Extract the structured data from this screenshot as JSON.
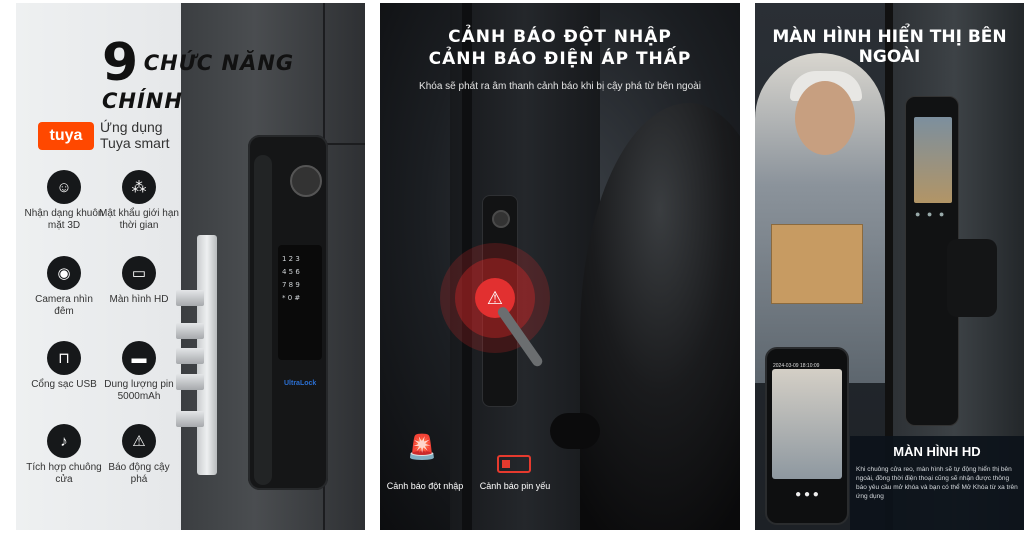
{
  "panel1": {
    "title_number": "9",
    "title_text": "CHỨC NĂNG CHÍNH",
    "app": {
      "logo": "tuya",
      "line1": "Ứng dụng",
      "line2": "Tuya smart"
    },
    "features": [
      {
        "icon": "face-scan-icon",
        "glyph": "☺",
        "label": "Nhận dạng khuôn mặt 3D"
      },
      {
        "icon": "password-timer-icon",
        "glyph": "⁂",
        "label": "Mật khẩu giới hạn thời gian"
      },
      {
        "icon": "camera-icon",
        "glyph": "◉",
        "label": "Camera nhìn đêm"
      },
      {
        "icon": "monitor-icon",
        "glyph": "▭",
        "label": "Màn hình HD"
      },
      {
        "icon": "usb-icon",
        "glyph": "⊓",
        "label": "Cổng sạc USB"
      },
      {
        "icon": "battery-icon",
        "glyph": "▬",
        "label": "Dung lượng pin 5000mAh"
      },
      {
        "icon": "bell-icon",
        "glyph": "♪",
        "label": "Tích hợp chuông cửa"
      },
      {
        "icon": "alarm-icon",
        "glyph": "⚠",
        "label": "Báo động cậy phá"
      }
    ],
    "lock_brand": "UltraLock"
  },
  "panel2": {
    "title1": "CẢNH BÁO ĐỘT NHẬP",
    "title2": "CẢNH BÁO ĐIỆN ÁP THẤP",
    "subtitle": "Khóa sẽ phát ra âm thanh cảnh báo khi bị cậy phá từ bên ngoài",
    "alert1": "Cảnh báo đột nhập",
    "alert2": "Cảnh báo pin yếu"
  },
  "panel3": {
    "title": "MÀN HÌNH HIỂN THỊ BÊN NGOÀI",
    "phone_timestamp": "2024-03-09 18:10:09",
    "hd_title": "MÀN HÌNH HD",
    "hd_desc": "Khi chuông cửa reo, màn hình sẽ tự động hiển thị bên ngoài, đồng thời điện thoại cũng sẽ nhận được thông báo yêu cầu mở khóa và bạn có thể Mở Khóa từ xa trên ứng dụng"
  }
}
